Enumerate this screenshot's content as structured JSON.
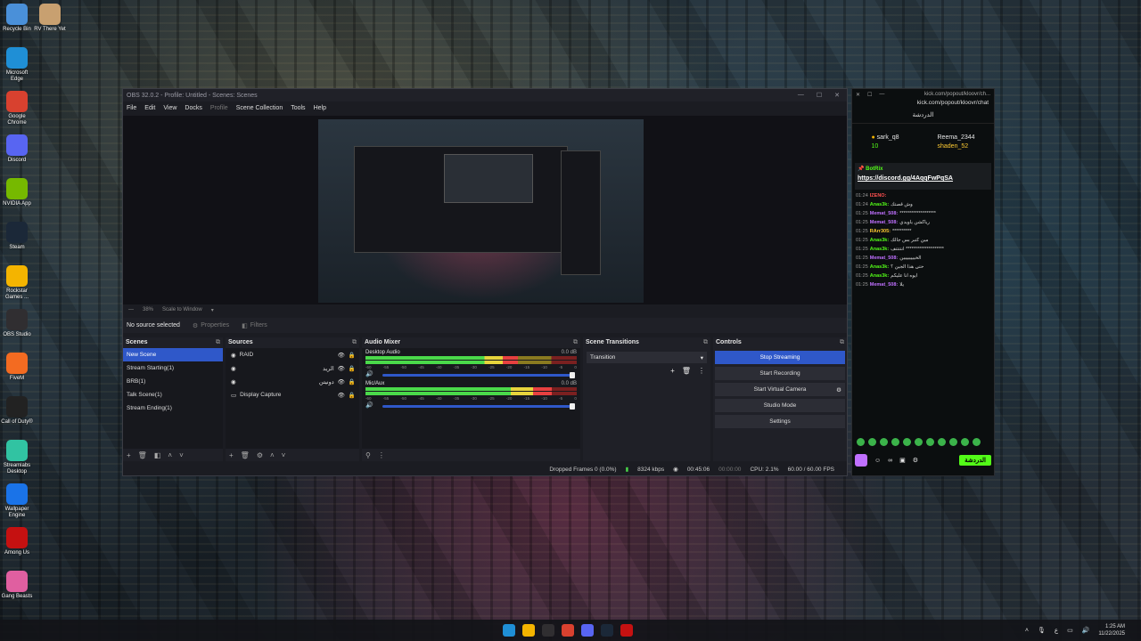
{
  "desktop": {
    "icons": [
      {
        "label": "Recycle Bin",
        "color": "#4a90d9"
      },
      {
        "label": "RV There Yet",
        "color": "#c8a070"
      },
      {
        "label": "Microsoft Edge",
        "color": "#1f8fd6"
      },
      {
        "label": "Google Chrome",
        "color": "#d8412f"
      },
      {
        "label": "Discord",
        "color": "#5865f2"
      },
      {
        "label": "NVIDIA App",
        "color": "#76b900"
      },
      {
        "label": "Steam",
        "color": "#1b2838"
      },
      {
        "label": "Rockstar Games ...",
        "color": "#f4b400"
      },
      {
        "label": "OBS Studio",
        "color": "#302e31"
      },
      {
        "label": "FiveM",
        "color": "#f36b21"
      },
      {
        "label": "Call of Duty®",
        "color": "#222222"
      },
      {
        "label": "Streamlabs Desktop",
        "color": "#31c3a2"
      },
      {
        "label": "Wallpaper Engine",
        "color": "#1a73e8"
      },
      {
        "label": "Among Us",
        "color": "#c51111"
      },
      {
        "label": "Gang Beasts",
        "color": "#e05fa0"
      }
    ]
  },
  "obs": {
    "title": "OBS 32.0.2 - Profile: Untitled - Scenes: Scenes",
    "menu": [
      "File",
      "Edit",
      "View",
      "Docks",
      "Profile",
      "Scene Collection",
      "Tools",
      "Help"
    ],
    "zoom": "38%",
    "scale_mode": "Scale to Window",
    "no_source": "No source selected",
    "properties_label": "Properties",
    "filters_label": "Filters",
    "scenes": {
      "header": "Scenes",
      "items": [
        "New Scene",
        "Stream Starting(1)",
        "BRB(1)",
        "Talk Scene(1)",
        "Stream Ending(1)"
      ],
      "selected": "New Scene"
    },
    "sources": {
      "header": "Sources",
      "items": [
        "RAID",
        "الريد",
        "دونيتن",
        "Display Capture"
      ]
    },
    "mixer": {
      "header": "Audio Mixer",
      "channels": [
        {
          "name": "Desktop Audio",
          "db": "0.0 dB",
          "level": 0.72
        },
        {
          "name": "Mic/Aux",
          "db": "0.0 dB",
          "level": 0.88
        }
      ],
      "ticks": [
        "-60",
        "-55",
        "-50",
        "-45",
        "-40",
        "-35",
        "-30",
        "-25",
        "-20",
        "-15",
        "-10",
        "-5",
        "0"
      ]
    },
    "transitions": {
      "header": "Scene Transitions",
      "selected": "Transition"
    },
    "controls": {
      "header": "Controls",
      "stop_streaming": "Stop Streaming",
      "start_recording": "Start Recording",
      "start_virtual_camera": "Start Virtual Camera",
      "studio_mode": "Studio Mode",
      "settings": "Settings"
    },
    "status": {
      "dropped": "Dropped Frames 0 (0.0%)",
      "bitrate": "8324 kbps",
      "stream_time": "00:45:06",
      "rec_time": "00:00:00",
      "cpu": "CPU: 2.1%",
      "fps": "60.00 / 60.00 FPS"
    }
  },
  "chat": {
    "title": "kick.com/popout/kloovr/ch...",
    "url": "kick.com/popout/kloovr/chat",
    "header": "الدردشة",
    "leaderboard": [
      {
        "name": "sark_q8",
        "count": "10"
      },
      {
        "name": "Reema_2344",
        "count": "1"
      },
      {
        "name": "shaden_52",
        "count": "1"
      }
    ],
    "pinned": {
      "by": "BotRix",
      "link": "https://discord.gg/4AqqFwPqSA"
    },
    "messages": [
      {
        "time": "01:24",
        "user": "IZENO:",
        "text": "",
        "color": "#ff5050"
      },
      {
        "time": "01:24",
        "user": "Anas3k:",
        "text": "وش قصتك",
        "color": "#53fc18"
      },
      {
        "time": "01:25",
        "user": "Memat_508:",
        "text": "*******************",
        "color": "#c070ff"
      },
      {
        "time": "01:25",
        "user": "Memat_508:",
        "text": "رياكشن ياويدي",
        "color": "#c070ff"
      },
      {
        "time": "01:25",
        "user": "RArr305:",
        "text": "**********",
        "color": "#ffcc33"
      },
      {
        "time": "01:25",
        "user": "Anas3k:",
        "text": "مين كتبر بس جالك",
        "color": "#53fc18"
      },
      {
        "time": "01:25",
        "user": "Anas3k:",
        "text": "انتتتتف ********************",
        "color": "#53fc18"
      },
      {
        "time": "01:25",
        "user": "Memat_508:",
        "text": "الخيييييييين",
        "color": "#c070ff"
      },
      {
        "time": "01:25",
        "user": "Anas3k:",
        "text": "حتى هذا الجين ؟",
        "color": "#53fc18"
      },
      {
        "time": "01:25",
        "user": "Anas3k:",
        "text": "ايوه انا عليكم",
        "color": "#53fc18"
      },
      {
        "time": "01:25",
        "user": "Memat_508:",
        "text": "يلا",
        "color": "#c070ff"
      }
    ],
    "send_label": "الدردشة"
  },
  "taskbar": {
    "time": "1:25 AM",
    "date": "11/22/2025",
    "lang": "ع"
  }
}
